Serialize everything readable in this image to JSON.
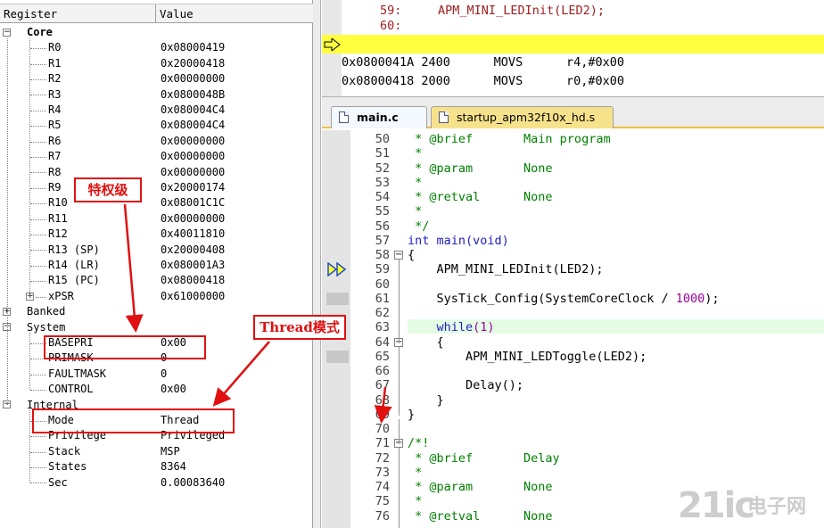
{
  "registers": {
    "header": {
      "name": "Register",
      "value": "Value"
    },
    "core_label": "Core",
    "core": [
      {
        "name": "R0",
        "value": "0x08000419"
      },
      {
        "name": "R1",
        "value": "0x20000418"
      },
      {
        "name": "R2",
        "value": "0x00000000"
      },
      {
        "name": "R3",
        "value": "0x0800048B"
      },
      {
        "name": "R4",
        "value": "0x080004C4"
      },
      {
        "name": "R5",
        "value": "0x080004C4"
      },
      {
        "name": "R6",
        "value": "0x00000000"
      },
      {
        "name": "R7",
        "value": "0x00000000"
      },
      {
        "name": "R8",
        "value": "0x00000000"
      },
      {
        "name": "R9",
        "value": "0x20000174"
      },
      {
        "name": "R10",
        "value": "0x08001C1C"
      },
      {
        "name": "R11",
        "value": "0x00000000"
      },
      {
        "name": "R12",
        "value": "0x40011810"
      },
      {
        "name": "R13 (SP)",
        "value": "0x20000408"
      },
      {
        "name": "R14 (LR)",
        "value": "0x080001A3"
      },
      {
        "name": "R15 (PC)",
        "value": "0x08000418"
      },
      {
        "name": "xPSR",
        "value": "0x61000000"
      }
    ],
    "banked_label": "Banked",
    "system_label": "System",
    "system": [
      {
        "name": "BASEPRI",
        "value": "0x00"
      },
      {
        "name": "PRIMASK",
        "value": "0"
      },
      {
        "name": "FAULTMASK",
        "value": "0"
      },
      {
        "name": "CONTROL",
        "value": "0x00"
      }
    ],
    "internal_label": "Internal",
    "internal": [
      {
        "name": "Mode",
        "value": "Thread"
      },
      {
        "name": "Privilege",
        "value": "Privileged"
      },
      {
        "name": "Stack",
        "value": "MSP"
      },
      {
        "name": "States",
        "value": "8364"
      },
      {
        "name": "Sec",
        "value": "0.00083640"
      }
    ]
  },
  "disassembly": [
    {
      "text": "        59:     APM_MINI_LEDInit(LED2);"
    },
    {
      "text": "        60:"
    },
    {
      "text": "0x08000418 2000      MOVS      r0,#0x00"
    },
    {
      "text": "0x0800041A 2400      MOVS      r4,#0x00"
    }
  ],
  "tabs": [
    {
      "label": "main.c"
    },
    {
      "label": "startup_apm32f10x_hd.s"
    }
  ],
  "source_lines": [
    {
      "no": "50",
      "text": " * @brief       Main program"
    },
    {
      "no": "51",
      "text": " *"
    },
    {
      "no": "52",
      "text": " * @param       None"
    },
    {
      "no": "53",
      "text": " *"
    },
    {
      "no": "54",
      "text": " * @retval      None"
    },
    {
      "no": "55",
      "text": " *"
    },
    {
      "no": "56",
      "text": " */"
    },
    {
      "no": "57",
      "text": "int main(void)"
    },
    {
      "no": "58",
      "text": "{"
    },
    {
      "no": "59",
      "text": "    APM_MINI_LEDInit(LED2);"
    },
    {
      "no": "60",
      "text": ""
    },
    {
      "no": "61",
      "text": "    SysTick_Config(SystemCoreClock / 1000);"
    },
    {
      "no": "62",
      "text": ""
    },
    {
      "no": "63",
      "text": "    while(1)"
    },
    {
      "no": "64",
      "text": "    {"
    },
    {
      "no": "65",
      "text": "        APM_MINI_LEDToggle(LED2);"
    },
    {
      "no": "66",
      "text": ""
    },
    {
      "no": "67",
      "text": "        Delay();"
    },
    {
      "no": "68",
      "text": "    }"
    },
    {
      "no": "69",
      "text": "}"
    },
    {
      "no": "70",
      "text": ""
    },
    {
      "no": "71",
      "text": "/*!"
    },
    {
      "no": "72",
      "text": " * @brief       Delay"
    },
    {
      "no": "73",
      "text": " *"
    },
    {
      "no": "74",
      "text": " * @param       None"
    },
    {
      "no": "75",
      "text": " *"
    },
    {
      "no": "76",
      "text": " * @retval      None"
    }
  ],
  "annotations": {
    "privilege_callout": "特权级",
    "thread_callout": "Thread模式"
  },
  "watermark": {
    "big": "21ic",
    "small": "电子网"
  },
  "colors": {
    "highlight_line": "#ffff40",
    "annotation_red": "#e01010",
    "comment_green": "#008000",
    "keyword_blue": "#2020c0"
  }
}
